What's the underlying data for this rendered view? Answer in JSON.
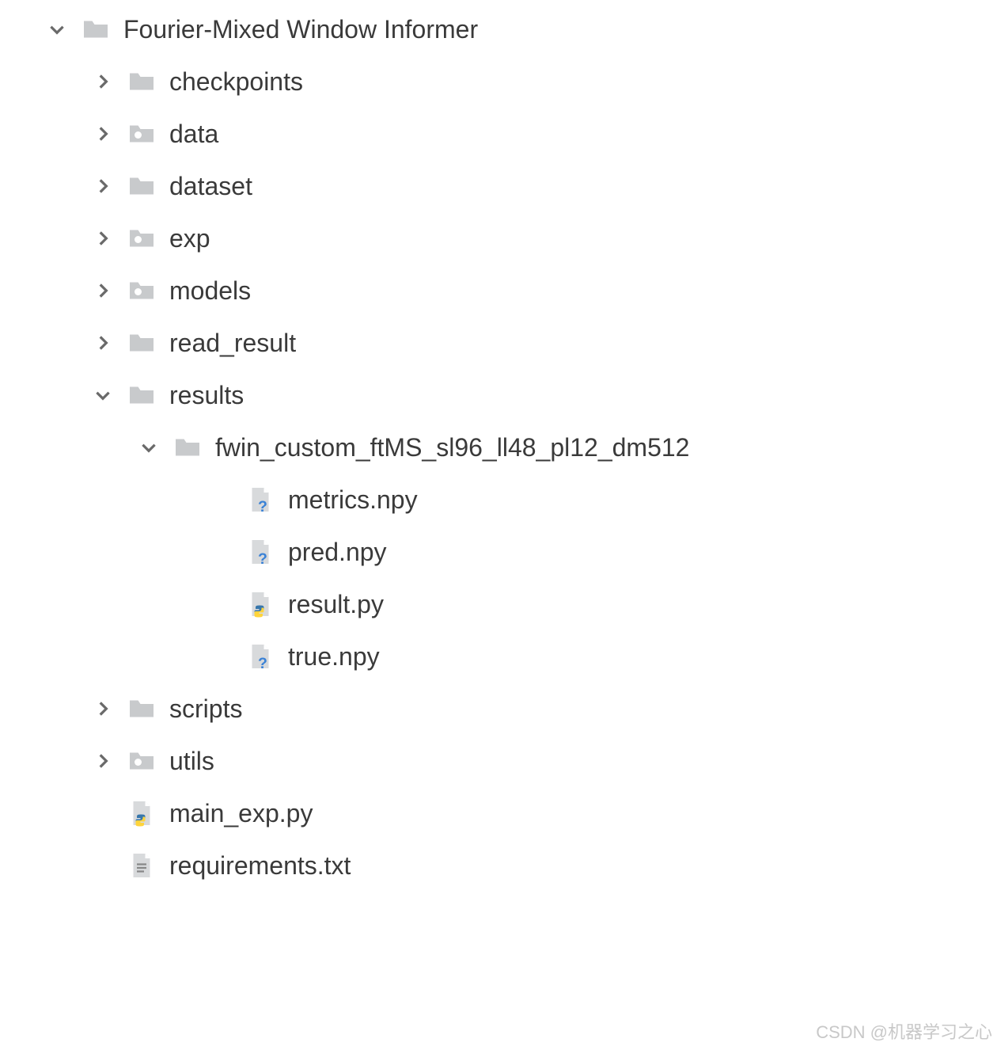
{
  "tree": {
    "root": {
      "label": "Fourier-Mixed Window Informer",
      "children": [
        {
          "label": "checkpoints",
          "icon": "folder",
          "expandable": true
        },
        {
          "label": "data",
          "icon": "folder-dot",
          "expandable": true
        },
        {
          "label": "dataset",
          "icon": "folder",
          "expandable": true
        },
        {
          "label": "exp",
          "icon": "folder-dot",
          "expandable": true
        },
        {
          "label": "models",
          "icon": "folder-dot",
          "expandable": true
        },
        {
          "label": "read_result",
          "icon": "folder",
          "expandable": true
        },
        {
          "label": "results",
          "icon": "folder",
          "expanded": true,
          "children": [
            {
              "label": "fwin_custom_ftMS_sl96_ll48_pl12_dm512",
              "icon": "folder",
              "expanded": true,
              "children": [
                {
                  "label": "metrics.npy",
                  "icon": "file-unknown"
                },
                {
                  "label": "pred.npy",
                  "icon": "file-unknown"
                },
                {
                  "label": "result.py",
                  "icon": "file-python"
                },
                {
                  "label": "true.npy",
                  "icon": "file-unknown"
                }
              ]
            }
          ]
        },
        {
          "label": "scripts",
          "icon": "folder",
          "expandable": true
        },
        {
          "label": "utils",
          "icon": "folder-dot",
          "expandable": true
        },
        {
          "label": "main_exp.py",
          "icon": "file-python"
        },
        {
          "label": "requirements.txt",
          "icon": "file-text"
        }
      ]
    }
  },
  "watermark": "CSDN @机器学习之心"
}
